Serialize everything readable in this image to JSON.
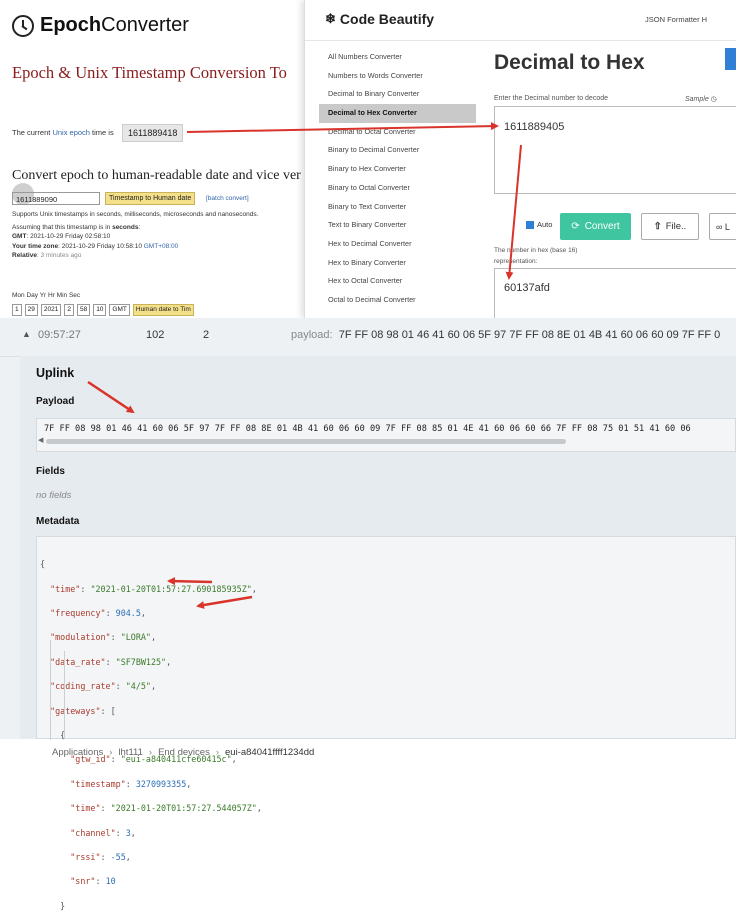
{
  "epoch": {
    "logo": {
      "prefix": "Epoch",
      "suffix": "Converter"
    },
    "title": "Epoch & Unix Timestamp Conversion To",
    "current_label_pre": "The current ",
    "current_label_link": "Unix epoch",
    "current_label_post": " time is",
    "current_value": "1611889418",
    "convert_heading": "Convert epoch to human-readable date and vice ver",
    "input_value": "1611889090",
    "timestamp_button": "Timestamp to Human date",
    "batch_link": "[batch convert]",
    "supports_note": "Supports Unix timestamps in seconds, milliseconds, microseconds and nanoseconds.",
    "assuming_pre": "Assuming that this timestamp is in ",
    "assuming_unit": "seconds",
    "gmt_label": "GMT",
    "gmt_value": ": 2021-10-29   Friday 02:58:10",
    "your_tz_label": "Your time zone",
    "your_tz_value": ":  2021-10-29 Friday  10:58:10 ",
    "your_tz_offset": "GMT+08:00",
    "relative_label": "Relative",
    "relative_value": ": 3 minutes ago",
    "date_fields_header": "Mon    Day    Yr             Hr      Min     Sec",
    "date_boxes": [
      "1",
      "29",
      "2021",
      "2",
      "58",
      "10",
      "GMT",
      "Human date to Tim"
    ]
  },
  "beautify": {
    "logo_icon": "paw-icon",
    "logo": "Code Beautify",
    "nav": "JSON Formatter   H",
    "sidebar": [
      "All Numbers Converter",
      "Numbers to Words Converter",
      "Decimal to Binary Converter",
      "Decimal to Hex Converter",
      "Decimal to Octal Converter",
      "Binary to Decimal Converter",
      "Binary to Hex Converter",
      "Binary to Octal Converter",
      "Binary to Text Converter",
      "Text to Binary Converter",
      "Hex to Decimal Converter",
      "Hex to Binary Converter",
      "Hex to Octal Converter",
      "Octal to Decimal Converter"
    ],
    "active_index": 3,
    "heading": "Decimal to Hex",
    "enter_label": "Enter the Decimal number to decode",
    "sample_label": "Sample",
    "input_value": "1611889405",
    "auto_label": "Auto",
    "convert_button": "Convert",
    "file_button": "File..",
    "link_button": "∞  L",
    "result_label_1": "The number in hex (base 16)",
    "result_label_2": "representation:",
    "result_value": "60137afd"
  },
  "ttn": {
    "row": {
      "time": "09:57:27",
      "port": "102",
      "count": "2",
      "payload_label": "payload:",
      "payload_value": "7F FF 08 98 01 46 41 60 06 5F 97 7F FF 08 8E 01 4B 41 60 06 60 09 7F FF 0"
    },
    "uplink_title": "Uplink",
    "payload_heading": "Payload",
    "payload_full": "7F FF 08 98 01 46 41 60 06 5F 97 7F FF 08 8E 01 4B 41 60 06 60 09 7F FF 08 85 01 4E 41 60 06 60 66 7F FF 08 75 01 51 41 60 06",
    "fields_heading": "Fields",
    "no_fields": "no fields",
    "metadata_heading": "Metadata",
    "metadata": {
      "open_brace": "{",
      "time_key": "\"time\"",
      "time_val": "\"2021-01-20T01:57:27.690185935Z\"",
      "freq_key": "\"frequency\"",
      "freq_val": "904.5",
      "mod_key": "\"modulation\"",
      "mod_val": "\"LORA\"",
      "dr_key": "\"data_rate\"",
      "dr_val": "\"SF7BW125\"",
      "cr_key": "\"coding_rate\"",
      "cr_val": "\"4/5\"",
      "gw_key": "\"gateways\"",
      "gw_open": "[",
      "gw_obj_open": "{",
      "gtw_id_key": "\"gtw_id\"",
      "gtw_id_val": "\"eui-a840411cfe60415c\"",
      "ts_key": "\"timestamp\"",
      "ts_val": "3270993355",
      "gtime_key": "\"time\"",
      "gtime_val": "\"2021-01-20T01:57:27.544057Z\"",
      "ch_key": "\"channel\"",
      "ch_val": "3",
      "rssi_key": "\"rssi\"",
      "rssi_val": "-55",
      "snr_key": "\"snr\"",
      "snr_val": "10",
      "gw_obj_close": "}"
    }
  },
  "breadcrumb": [
    "Applications",
    "lht111",
    "End devices",
    "eui-a84041ffff1234dd"
  ],
  "colors": {
    "annotation_red": "#d9342b",
    "convert_green": "#3fc5a0",
    "epoch_title": "#8a1c1c"
  }
}
